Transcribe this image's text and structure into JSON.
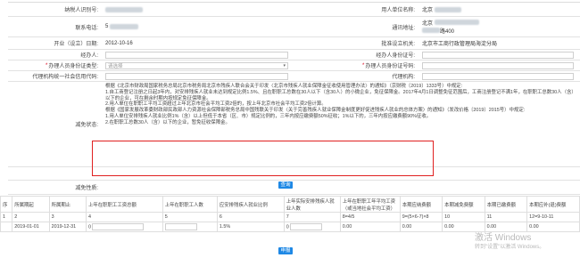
{
  "form": {
    "taxpayer_id_label": "纳税人识别号:",
    "user_unit_name_label": "用人单位名称:",
    "user_unit_name_value": "北京",
    "phone_label": "联系电话:",
    "phone_value": "5",
    "address_label": "通讯地址:",
    "address_value": "北京",
    "address_value_2": "路400",
    "founded_label": "开业（设立）日期:",
    "founded_value": "2012-10-16",
    "approver_label": "批准设立机关:",
    "approver_value": "北京市工商行政管理局海淀分局",
    "handler_label": "经办人:",
    "handler_id_label": "经办人身份证号:",
    "handler_id_type_label": "办理人员身份证类型:",
    "handler_id_type_value": "请选择",
    "handler_id_number_label": "办理人员身份证号码:",
    "agent_credit_label": "代理机构统一社会信用代码:",
    "agent_org_label": "代理机构:",
    "reduction_status_label": "减免状态:",
    "reduction_text": [
      "根据《北京市财政局国家税务总局北京市税务局北京市残疾人联合会关于印发〈北京市残疾人就业保障金征收使用管理办法〉的通知》（京财税〔2019〕1333号）中规定:",
      "1.自工商登记注册之日起3年内，对安排残疾人就业未达到规定比例1.5%、且在职职工总数在30人以下（含30人）的小微企业，免征保障金。2017年4月1日调整免征范围后，工商注册登记不满1年，在职职工总数30人（含）以下的企业，可在剩余时期内按规定免征保障金。",
      "2.用人单位在职职工平均工资超过上年北京市社会平均工资2倍的，按上年北京市社会平均工资2倍计算。",
      "根据《国家发展改革委财政部民政部人力资源社会保障部税务总局中国残联关于印发〈关于完善残疾人就业保障金制度更好促进残疾人就业的总体方案〉的通知》（发改价格〔2019〕2015号）中规定:",
      "1.用人单位安排残疾人就业比例1%（含）以上但低于本省（区、市）规定比例的，三年内按应缴费额50%征收；1%以下的，三年内按应缴费额90%征收。",
      "2.在职职工总数30人（含）以下的企业，暂免征收保障金。"
    ],
    "reduction_nature_label": "减免性质:"
  },
  "buttons": {
    "query_label": "查询",
    "declare_label": "申报"
  },
  "table": {
    "headers": [
      "所属期起",
      "所属期止",
      "上年在职职工工资总额",
      "上年在职职工人数",
      "应安排残疾人就业比例",
      "上年实际安排残疾人就业人数",
      "上年在职职工年平均工资（或当地社会平均工资）",
      "本期应纳费额",
      "本期减免费额",
      "本期已缴费额",
      "本期应补(退)费额"
    ],
    "index_row": [
      "1",
      "2",
      "3",
      "4",
      "5",
      "6",
      "7",
      "8=4/5",
      "9=(5×6-7)×8",
      "10",
      "11",
      "12=9-10-11"
    ],
    "data_row": {
      "c1": "2019-01-01",
      "c2": "2019-12-31",
      "c3": "0",
      "c5": "1.5%",
      "c6": "0",
      "c7": "0.00",
      "c8": "0.00",
      "c9": "0.00",
      "c10": "0.00",
      "c11": "0.00"
    },
    "first_col_header": "序"
  },
  "watermark": {
    "line1": "激活 Windows",
    "line2": "转到\"设置\"以激活 Windows。"
  }
}
